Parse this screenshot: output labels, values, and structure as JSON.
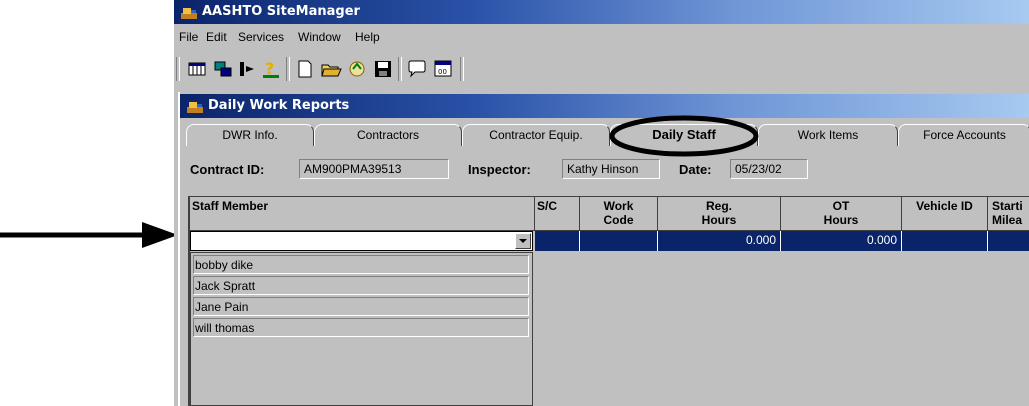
{
  "app": {
    "title": "AASHTO SiteManager",
    "menu": [
      "File",
      "Edit",
      "Services",
      "Window",
      "Help"
    ]
  },
  "child_window": {
    "title": "Daily Work Reports",
    "tabs": [
      "DWR Info.",
      "Contractors",
      "Contractor Equip.",
      "Daily Staff",
      "Work Items",
      "Force Accounts"
    ],
    "active_tab": "Daily Staff"
  },
  "header_fields": {
    "contract_id_label": "Contract ID:",
    "contract_id": "AM900PMA39513",
    "inspector_label": "Inspector:",
    "inspector": "Kathy Hinson",
    "date_label": "Date:",
    "date": "05/23/02"
  },
  "grid": {
    "columns": [
      {
        "l1": "Staff Member",
        "l2": ""
      },
      {
        "l1": "S/C",
        "l2": ""
      },
      {
        "l1": "Work",
        "l2": "Code"
      },
      {
        "l1": "Reg.",
        "l2": "Hours"
      },
      {
        "l1": "OT",
        "l2": "Hours"
      },
      {
        "l1": "",
        "l2": "Vehicle ID"
      },
      {
        "l1": "Starti",
        "l2": "Milea"
      }
    ],
    "row": {
      "staff_member": "",
      "sc": "",
      "work_code": "",
      "reg_hours": "0.000",
      "ot_hours": "0.000",
      "vehicle_id": "",
      "starting_mileage": ""
    }
  },
  "staff_dropdown": {
    "options": [
      "bobby dike",
      "Jack Spratt",
      "Jane Pain",
      "will thomas"
    ]
  },
  "icons": {
    "annotation": "arrow-right-icon",
    "highlight": "ellipse-highlight"
  },
  "colors": {
    "title_gradient_start": "#0a246a",
    "selected_row": "#0a246a",
    "face": "#c0c0c0"
  }
}
